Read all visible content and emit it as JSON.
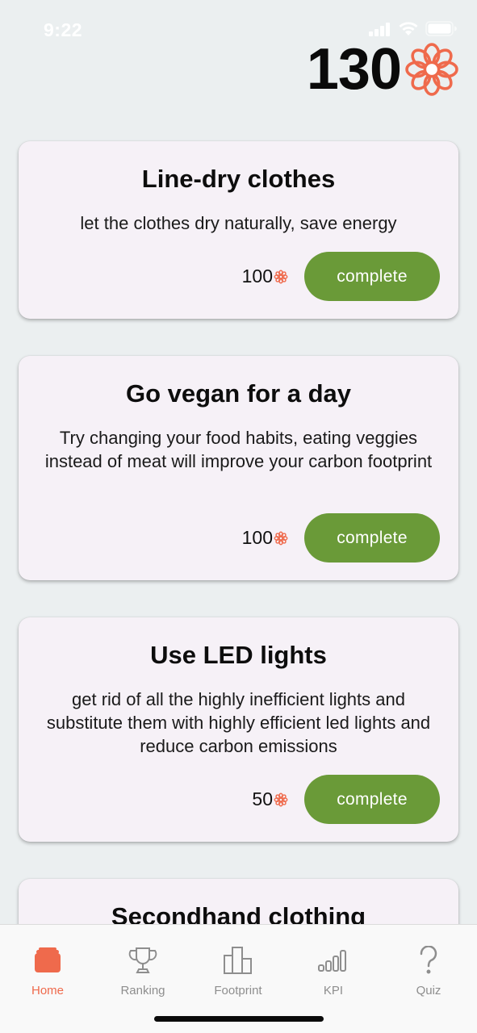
{
  "status_bar": {
    "time": "9:22"
  },
  "header": {
    "points": "130",
    "points_icon": "flower-icon",
    "accent_color": "#ef6a4c"
  },
  "tasks": [
    {
      "title": "Line-dry clothes",
      "description": "let the clothes dry naturally, save energy",
      "points": "100",
      "button_label": "complete"
    },
    {
      "title": "Go vegan for a day",
      "description": "Try changing your food habits, eating veggies instead of meat will improve your carbon footprint",
      "points": "100",
      "button_label": "complete"
    },
    {
      "title": "Use LED lights",
      "description": "get rid of all the highly inefficient lights and substitute them with highly efficient led lights and reduce carbon emissions",
      "points": "50",
      "button_label": "complete"
    },
    {
      "title": "Secondhand clothing",
      "description": "",
      "points": "",
      "button_label": ""
    }
  ],
  "colors": {
    "button": "#6a9a38",
    "card_background": "#f6f1f7",
    "page_background": "#ebeff0",
    "tab_active": "#ef6a4c",
    "tab_inactive": "#8e8e8e"
  },
  "tab_bar": {
    "items": [
      {
        "label": "Home",
        "icon": "home-icon",
        "active": true
      },
      {
        "label": "Ranking",
        "icon": "trophy-icon",
        "active": false
      },
      {
        "label": "Footprint",
        "icon": "bar-chart-icon",
        "active": false
      },
      {
        "label": "KPI",
        "icon": "signal-bars-icon",
        "active": false
      },
      {
        "label": "Quiz",
        "icon": "question-icon",
        "active": false
      }
    ]
  }
}
